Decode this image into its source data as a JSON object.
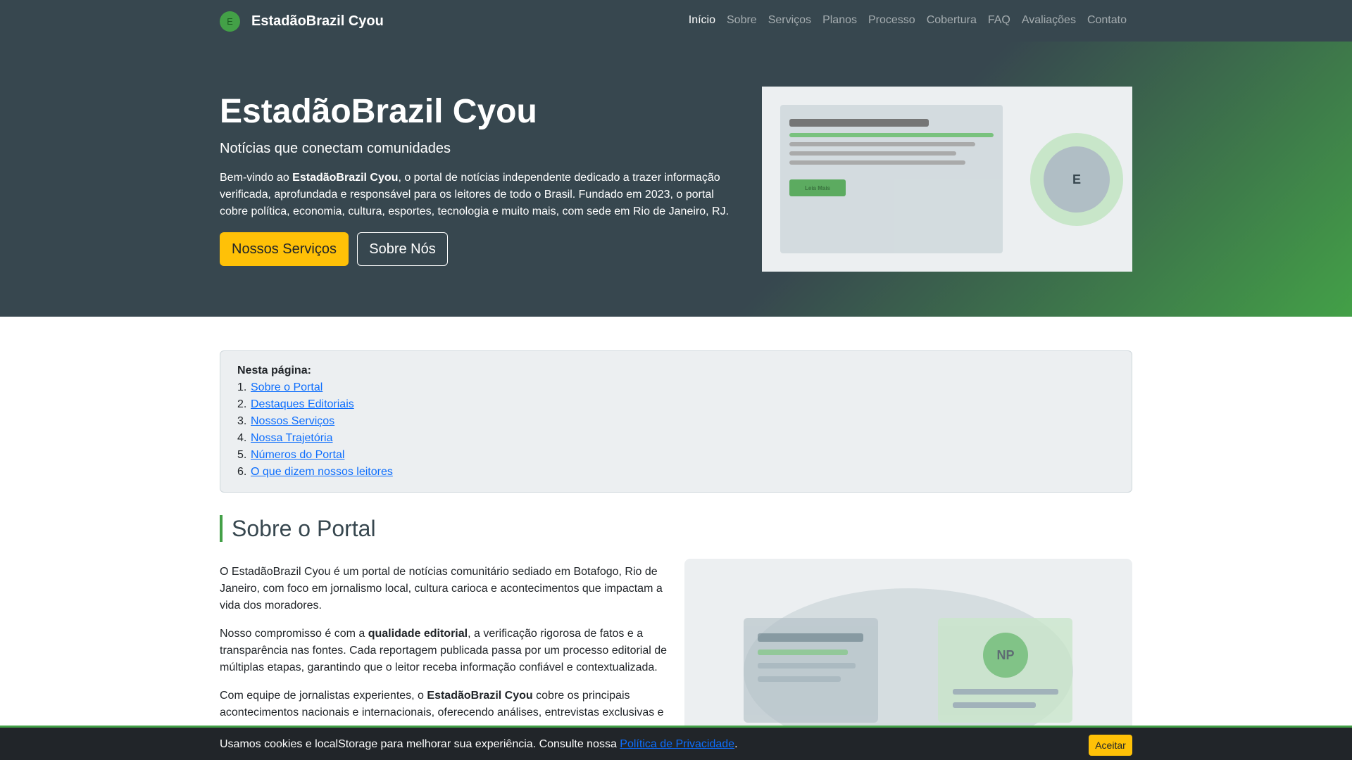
{
  "brand": {
    "logo_letter": "E",
    "name": "EstadãoBrazil Cyou"
  },
  "nav": {
    "items": [
      {
        "label": "Início",
        "active": true
      },
      {
        "label": "Sobre"
      },
      {
        "label": "Serviços"
      },
      {
        "label": "Planos"
      },
      {
        "label": "Processo"
      },
      {
        "label": "Cobertura"
      },
      {
        "label": "FAQ"
      },
      {
        "label": "Avaliações"
      },
      {
        "label": "Contato"
      }
    ]
  },
  "hero": {
    "title": "EstadãoBrazil Cyou",
    "subtitle": "Notícias que conectam comunidades",
    "text_prefix": "Bem-vindo ao ",
    "text_bold": "EstadãoBrazil Cyou",
    "text_suffix": ", o portal de notícias independente dedicado a trazer informação verificada, aprofundada e responsável para os leitores de todo o Brasil. Fundado em 2023, o portal cobre política, economia, cultura, esportes, tecnologia e muito mais, com sede em Rio de Janeiro, RJ.",
    "primary_button": "Nossos Serviços",
    "secondary_button": "Sobre Nós",
    "illustration": {
      "button_label": "Leia Mais",
      "circle_letter": "E"
    }
  },
  "toc": {
    "title": "Nesta página:",
    "items": [
      {
        "num": "1.",
        "label": "Sobre o Portal"
      },
      {
        "num": "2.",
        "label": "Destaques Editoriais"
      },
      {
        "num": "3.",
        "label": "Nossos Serviços"
      },
      {
        "num": "4.",
        "label": "Nossa Trajetória"
      },
      {
        "num": "5.",
        "label": "Números do Portal"
      },
      {
        "num": "6.",
        "label": "O que dizem nossos leitores"
      }
    ]
  },
  "about": {
    "title": "Sobre o Portal",
    "p1": "O EstadãoBrazil Cyou é um portal de notícias comunitário sediado em Botafogo, Rio de Janeiro, com foco em jornalismo local, cultura carioca e acontecimentos que impactam a vida dos moradores.",
    "p2_prefix": "Nosso compromisso é com a ",
    "p2_bold": "qualidade editorial",
    "p2_suffix": ", a verificação rigorosa de fatos e a transparência nas fontes. Cada reportagem publicada passa por um processo editorial de múltiplas etapas, garantindo que o leitor receba informação confiável e contextualizada.",
    "p3_prefix": "Com equipe de jornalistas experientes, o ",
    "p3_bold": "EstadãoBrazil Cyou",
    "p3_suffix": " cobre os principais acontecimentos nacionais e internacionais, oferecendo análises, entrevistas exclusivas e",
    "illustration": {
      "avatar_initials": "NP"
    }
  },
  "cookie": {
    "text": "Usamos cookies e localStorage para melhorar sua experiência. Consulte nossa ",
    "link": "Política de Privacidade",
    "after": ".",
    "button": "Aceitar"
  },
  "colors": {
    "navbar": "#37474f",
    "accent_green": "#43a047",
    "accent_yellow": "#ffc107",
    "link_blue": "#0d6efd"
  }
}
